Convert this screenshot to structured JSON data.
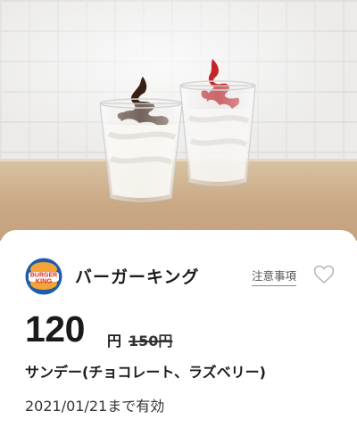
{
  "hero": {
    "image_description_icon": "sundae-photo"
  },
  "coupon": {
    "brand": "バーガーキング",
    "notes_link": "注意事項",
    "price": "120",
    "price_unit": "円",
    "old_price": "150円",
    "product": "サンデー(チョコレート、ラズベリー)",
    "expiry": "2021/01/21まで有効"
  },
  "logo": {
    "top_text": "BURGER",
    "bottom_text": "KING"
  },
  "colors": {
    "bk_red": "#d72d1e",
    "bk_bun": "#f2a43a",
    "bk_blue": "#1f5ca8",
    "heart_outline": "#b5b5b5"
  }
}
